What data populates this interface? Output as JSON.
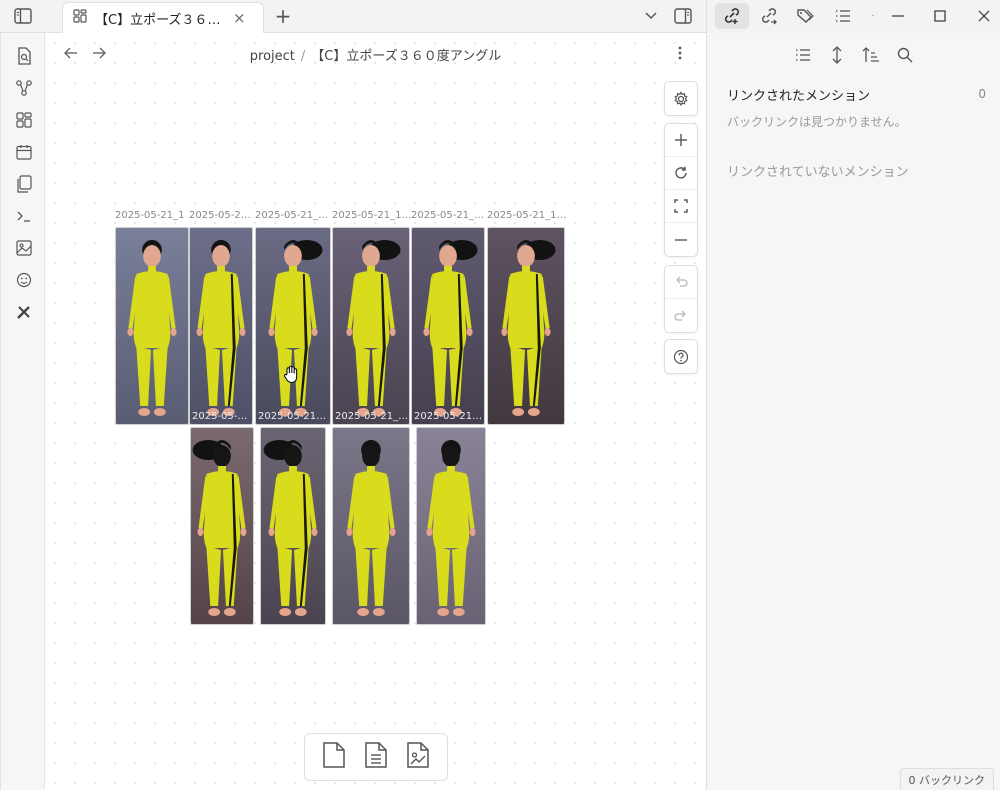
{
  "titlebar": {
    "tab_title": "【C】立ポーズ３６０度アングル",
    "new_tab_symbol": "+"
  },
  "breadcrumb": {
    "folder": "project",
    "separator": "/",
    "file": "【C】立ポーズ３６０度アングル"
  },
  "canvas": {
    "row1_labels": [
      "2025-05-21_1",
      "2025-05-21_1...",
      "2025-05-21_1...",
      "2025-05-21_13...",
      "2025-05-21_1...",
      "2025-05-21_13..."
    ],
    "row1_inner_labels": [
      "",
      "2025-05-21_...",
      "2025-05-21_...",
      "2025-05-21_13...",
      "2025-05-21_...",
      ""
    ]
  },
  "backlinks": {
    "linked_heading": "リンクされたメンション",
    "linked_count": "0",
    "linked_empty": "バックリンクは見つかりません。",
    "unlinked_heading": "リンクされていないメンション"
  },
  "status": {
    "backlink_count": "0 バックリンク"
  },
  "colors": {
    "accent": "#7b6cd9",
    "suit": "#d8dc1c",
    "stripe": "#1a1a0a"
  }
}
